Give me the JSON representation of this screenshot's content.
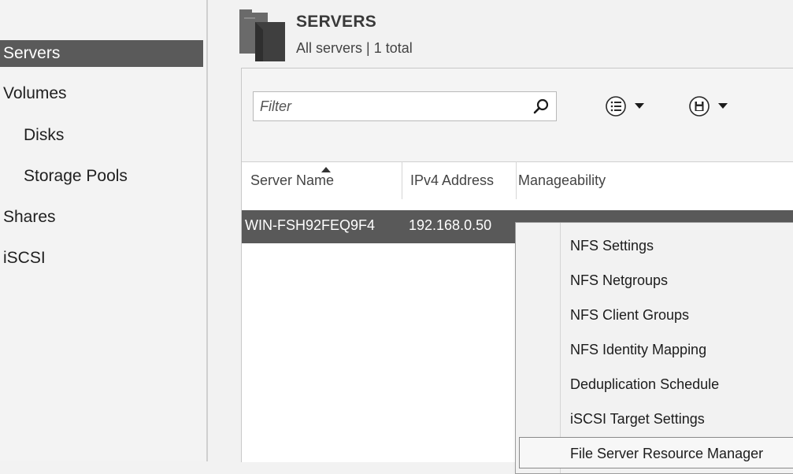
{
  "nav": {
    "items": [
      {
        "label": "Servers",
        "selected": true,
        "indent": false
      },
      {
        "label": "Volumes",
        "selected": false,
        "indent": false
      },
      {
        "label": "Disks",
        "selected": false,
        "indent": true
      },
      {
        "label": "Storage Pools",
        "selected": false,
        "indent": true
      },
      {
        "label": "Shares",
        "selected": false,
        "indent": false
      },
      {
        "label": "iSCSI",
        "selected": false,
        "indent": false
      }
    ]
  },
  "header": {
    "title": "SERVERS",
    "subtitle": "All servers | 1 total",
    "icon": "server-folder-icon"
  },
  "toolbar": {
    "filter_placeholder": "Filter",
    "search_icon": "search-icon",
    "list_view_icon": "list-options-icon",
    "save_icon": "save-query-icon"
  },
  "table": {
    "columns": [
      "Server Name",
      "IPv4 Address",
      "Manageability"
    ],
    "sorted_column": "Server Name",
    "rows": [
      {
        "server_name": "WIN-FSH92FEQ9F4",
        "ipv4": "192.168.0.50",
        "manageability": "",
        "selected": true
      }
    ]
  },
  "context_menu": {
    "items": [
      "NFS Settings",
      "NFS Netgroups",
      "NFS Client Groups",
      "NFS Identity Mapping",
      "Deduplication Schedule",
      "iSCSI Target Settings",
      "File Server Resource Manager"
    ],
    "hovered_index": 6
  },
  "colors": {
    "selection": "#595959",
    "background": "#f2f2f2",
    "pane": "#ffffff"
  }
}
